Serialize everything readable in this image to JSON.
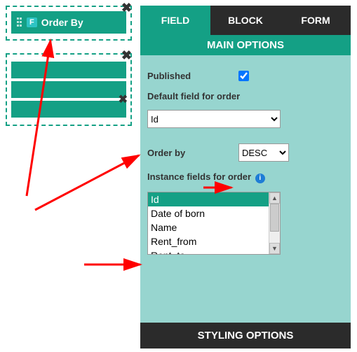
{
  "left": {
    "badge": "F",
    "order_by_label": "Order By"
  },
  "tabs": {
    "field": "FIELD",
    "block": "BLOCK",
    "form": "FORM"
  },
  "main_options_label": "MAIN OPTIONS",
  "form_fields": {
    "published_label": "Published",
    "published_checked": true,
    "default_field_label": "Default field for order",
    "default_field_value": "Id",
    "order_by_label": "Order by",
    "order_by_value": "DESC",
    "instance_fields_label": "Instance fields for order",
    "instance_list": [
      "Id",
      "Date of born",
      "Name",
      "Rent_from",
      "Rent_to"
    ],
    "instance_selected": "Id"
  },
  "styling_label": "STYLING OPTIONS"
}
